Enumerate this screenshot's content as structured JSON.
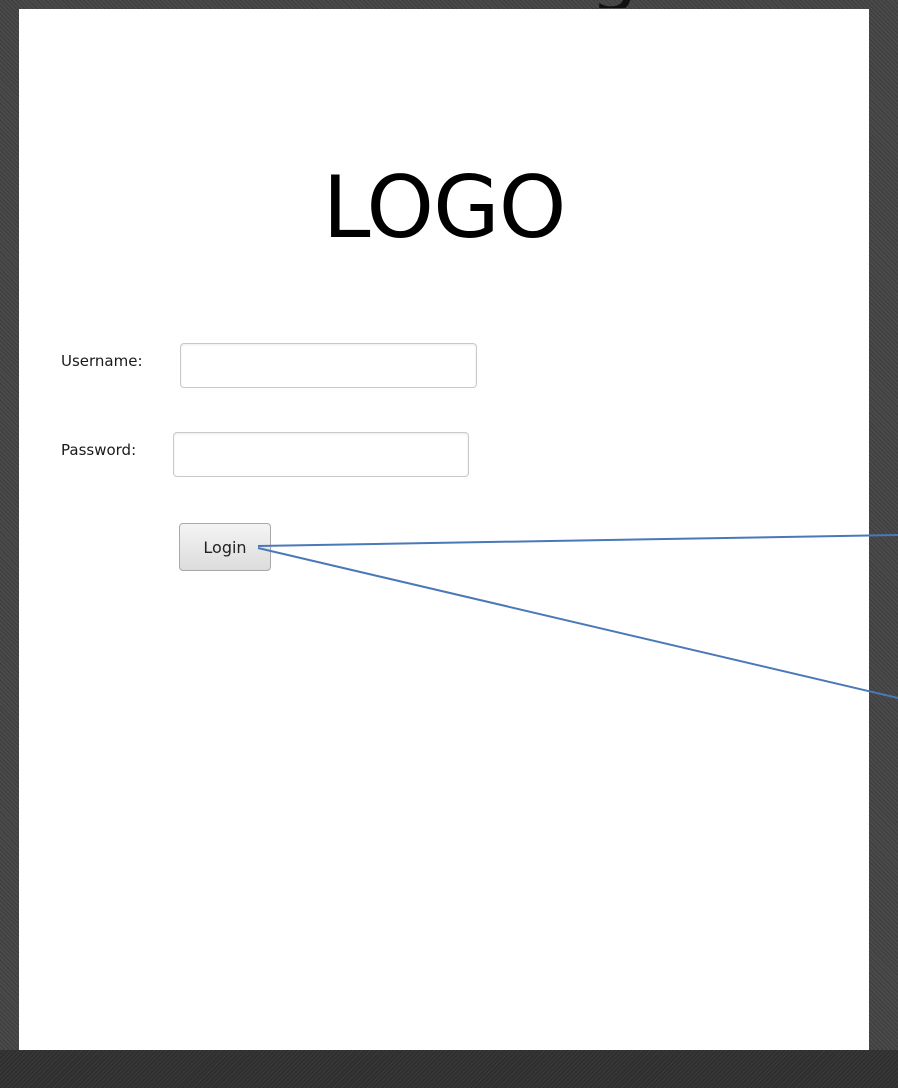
{
  "logo": {
    "text": "LOGO"
  },
  "form": {
    "username_label": "Username:",
    "username_value": "",
    "password_label": "Password:",
    "password_value": "",
    "login_label": "Login"
  },
  "colors": {
    "callout_line": "#4a78b8",
    "background": "#4a4a4a",
    "window": "#ffffff"
  }
}
